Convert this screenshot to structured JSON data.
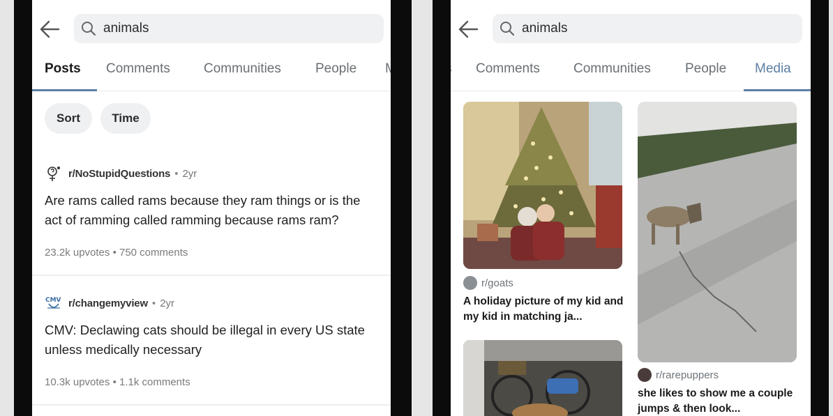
{
  "left": {
    "search": {
      "query": "animals"
    },
    "tabs": [
      "Posts",
      "Comments",
      "Communities",
      "People",
      "M"
    ],
    "chips": [
      "Sort",
      "Time"
    ],
    "posts": [
      {
        "subreddit": "r/NoStupidQuestions",
        "age": "2yr",
        "title": "Are rams called rams because they ram things or is the act of ramming called ramming because rams ram?",
        "stats": "23.2k upvotes • 750 comments",
        "icon": "question-mascot-icon"
      },
      {
        "subreddit": "r/changemyview",
        "age": "2yr",
        "title": "CMV: Declawing cats should be illegal in every US state unless medically necessary",
        "stats": "10.3k upvotes • 1.1k comments",
        "icon": "cmv-logo-icon"
      }
    ]
  },
  "right": {
    "search": {
      "query": "animals"
    },
    "tabs": [
      "s",
      "Comments",
      "Communities",
      "People",
      "Media"
    ],
    "cards": [
      {
        "subreddit": "r/goats",
        "title": "A holiday picture of my kid and my kid in matching ja...",
        "image": "christmas-tree-photo"
      },
      {
        "subreddit": "r/rarepuppers",
        "title": "she likes to show me a couple jumps & then look...",
        "image": "dog-on-slope-photo"
      },
      {
        "subreddit": "",
        "title": "",
        "image": "bikes-photo"
      }
    ]
  },
  "colors": {
    "accent_underline": "#5c7fa3",
    "chip_bg": "#eef0f2",
    "search_bg": "#f0f1f3"
  }
}
